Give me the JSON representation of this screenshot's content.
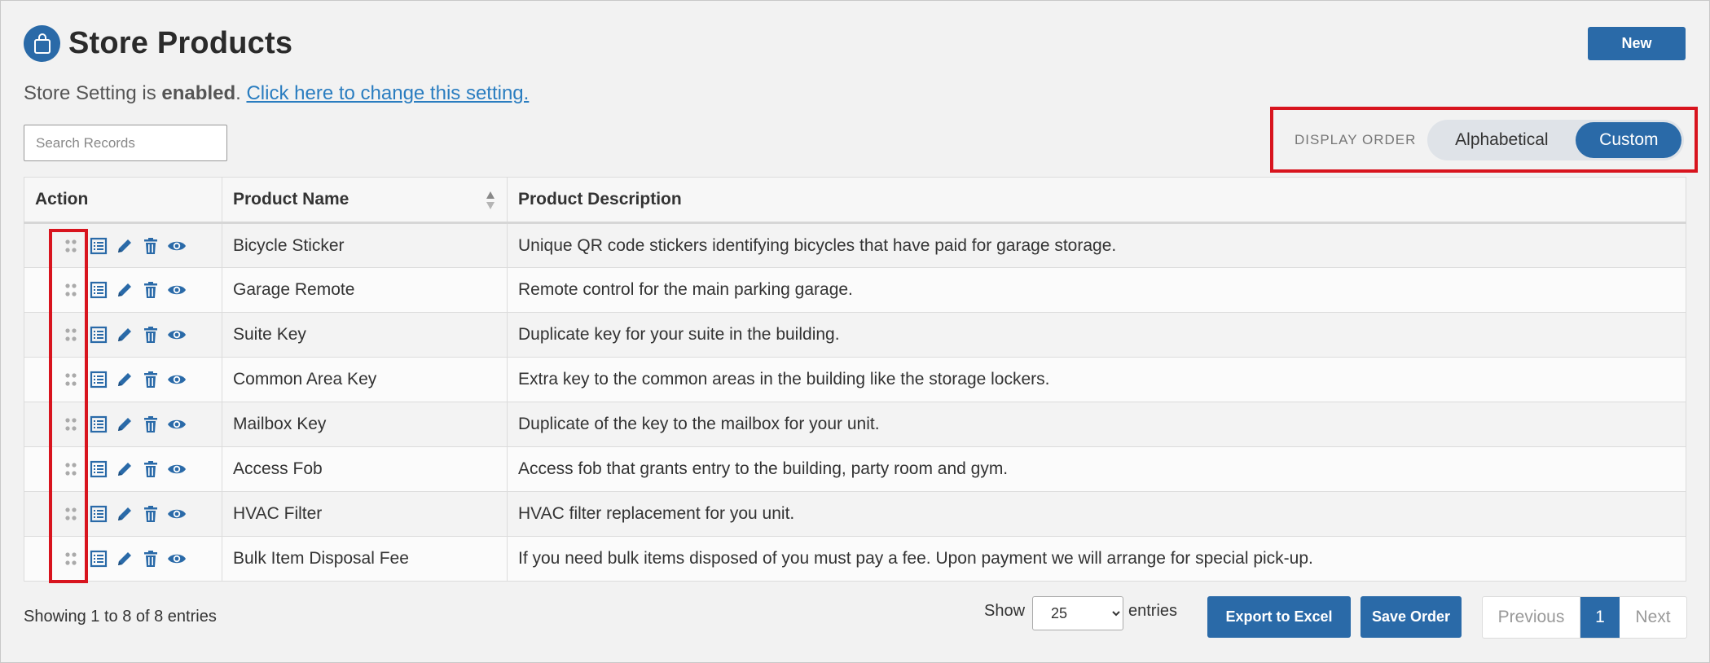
{
  "header": {
    "title": "Store Products",
    "new_label": "New"
  },
  "setting": {
    "prefix": "Store Setting is ",
    "status": "enabled",
    "suffix": ". ",
    "link": "Click here to change this setting."
  },
  "search": {
    "placeholder": "Search Records",
    "value": ""
  },
  "display_order": {
    "label": "DISPLAY ORDER",
    "options": [
      "Alphabetical",
      "Custom"
    ],
    "selected": "Custom"
  },
  "table": {
    "columns": [
      "Action",
      "Product Name",
      "Product Description"
    ],
    "rows": [
      {
        "name": "Bicycle Sticker",
        "description": "Unique QR code stickers identifying bicycles that have paid for garage storage."
      },
      {
        "name": "Garage Remote",
        "description": "Remote control for the main parking garage."
      },
      {
        "name": "Suite Key",
        "description": "Duplicate key for your suite in the building."
      },
      {
        "name": "Common Area Key",
        "description": "Extra key to the common areas in the building like the storage lockers."
      },
      {
        "name": "Mailbox Key",
        "description": "Duplicate of the key to the mailbox for your unit."
      },
      {
        "name": "Access Fob",
        "description": "Access fob that grants entry to the building, party room and gym."
      },
      {
        "name": "HVAC Filter",
        "description": "HVAC filter replacement for you unit."
      },
      {
        "name": "Bulk Item Disposal Fee",
        "description": "If you need bulk items disposed of you must pay a fee. Upon payment we will arrange for special pick-up."
      }
    ],
    "row_action_icons": [
      "drag-handle-icon",
      "details-list-icon",
      "edit-pencil-icon",
      "delete-trash-icon",
      "view-eye-icon"
    ]
  },
  "footer": {
    "info": "Showing 1 to 8 of 8 entries",
    "show_label": "Show",
    "page_size": "25",
    "page_size_options": [
      "25"
    ],
    "entries_label": "entries",
    "export_label": "Export to Excel",
    "save_order_label": "Save Order",
    "prev_label": "Previous",
    "current_page": "1",
    "next_label": "Next"
  },
  "colors": {
    "accent": "#2a6aa8",
    "highlight": "#d8141e",
    "background": "#f2f2f2"
  }
}
